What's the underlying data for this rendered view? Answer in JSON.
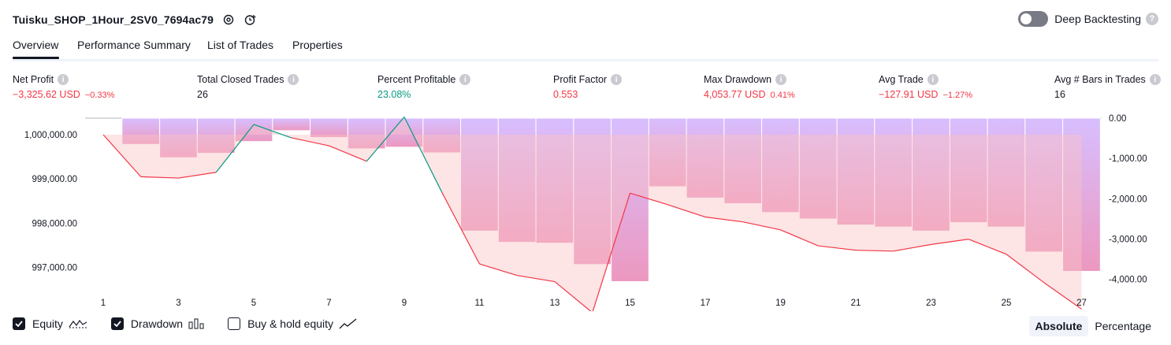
{
  "header": {
    "title": "Tuisku_SHOP_1Hour_2SV0_7694ac79",
    "deep_backtesting_label": "Deep Backtesting",
    "deep_backtesting_enabled": false
  },
  "tabs": [
    {
      "label": "Overview",
      "active": true
    },
    {
      "label": "Performance Summary",
      "active": false
    },
    {
      "label": "List of Trades",
      "active": false
    },
    {
      "label": "Properties",
      "active": false
    }
  ],
  "metrics": [
    {
      "label": "Net Profit",
      "value": "−3,325.62 USD",
      "pct": "−0.33%",
      "tone": "neg"
    },
    {
      "label": "Total Closed Trades",
      "value": "26",
      "pct": "",
      "tone": "neu"
    },
    {
      "label": "Percent Profitable",
      "value": "23.08%",
      "pct": "",
      "tone": "pos"
    },
    {
      "label": "Profit Factor",
      "value": "0.553",
      "pct": "",
      "tone": "neg"
    },
    {
      "label": "Max Drawdown",
      "value": "4,053.77 USD",
      "pct": "0.41%",
      "tone": "neg"
    },
    {
      "label": "Avg Trade",
      "value": "−127.91 USD",
      "pct": "−1.27%",
      "tone": "neg"
    },
    {
      "label": "Avg # Bars in Trades",
      "value": "16",
      "pct": "",
      "tone": "neu"
    }
  ],
  "legend": {
    "equity_label": "Equity",
    "equity_checked": true,
    "drawdown_label": "Drawdown",
    "drawdown_checked": true,
    "buyhold_label": "Buy & hold equity",
    "buyhold_checked": false
  },
  "modes": {
    "absolute_label": "Absolute",
    "percentage_label": "Percentage",
    "active": "absolute"
  },
  "colors": {
    "equity_line": "#f23645",
    "equity_up": "#089981",
    "drawdown_bar": "#d1b3ff",
    "drawdown_bar_deep": "#e986b4",
    "loss_fill": "#fbc3c6"
  },
  "chart_data": {
    "type": "bar+line",
    "x_ticks": [
      "1",
      "3",
      "5",
      "7",
      "9",
      "11",
      "13",
      "15",
      "17",
      "19",
      "21",
      "23",
      "25",
      "27"
    ],
    "equity": {
      "x": [
        1,
        2,
        3,
        4,
        5,
        6,
        7,
        8,
        9,
        10,
        11,
        12,
        13,
        14,
        15,
        16,
        17,
        18,
        19,
        20,
        21,
        22,
        23,
        24,
        25,
        26,
        27
      ],
      "values": [
        1000000.0,
        999050,
        999020,
        999150,
        1000230,
        999930,
        999750,
        999400,
        1000400,
        998700,
        997080,
        996820,
        996680,
        995980,
        998680,
        998420,
        998140,
        998030,
        997850,
        997490,
        997390,
        997370,
        997520,
        997640,
        997300,
        996660,
        996060
      ]
    },
    "drawdown": {
      "x": [
        1,
        2,
        3,
        4,
        5,
        6,
        7,
        8,
        9,
        10,
        11,
        12,
        13,
        14,
        15,
        16,
        17,
        18,
        19,
        20,
        21,
        22,
        23,
        24,
        25,
        26,
        27
      ],
      "values": [
        0,
        -650,
        -980,
        -870,
        -580,
        -310,
        -480,
        -760,
        -720,
        -860,
        -2800,
        -3080,
        -3100,
        -3630,
        -4053.77,
        -1700,
        -1980,
        -2120,
        -2340,
        -2500,
        -2650,
        -2700,
        -2800,
        -2590,
        -2700,
        -3320,
        -3800
      ]
    },
    "left_axis": {
      "ticks": [
        "1,000,000.00",
        "999,000.00",
        "998,000.00",
        "997,000.00"
      ],
      "values": [
        1000000,
        999000,
        998000,
        997000
      ]
    },
    "right_axis": {
      "ticks": [
        "0.00",
        "-1,000.00",
        "-2,000.00",
        "-3,000.00",
        "-4,000.00"
      ],
      "values": [
        0,
        -1000,
        -2000,
        -3000,
        -4000
      ]
    }
  }
}
